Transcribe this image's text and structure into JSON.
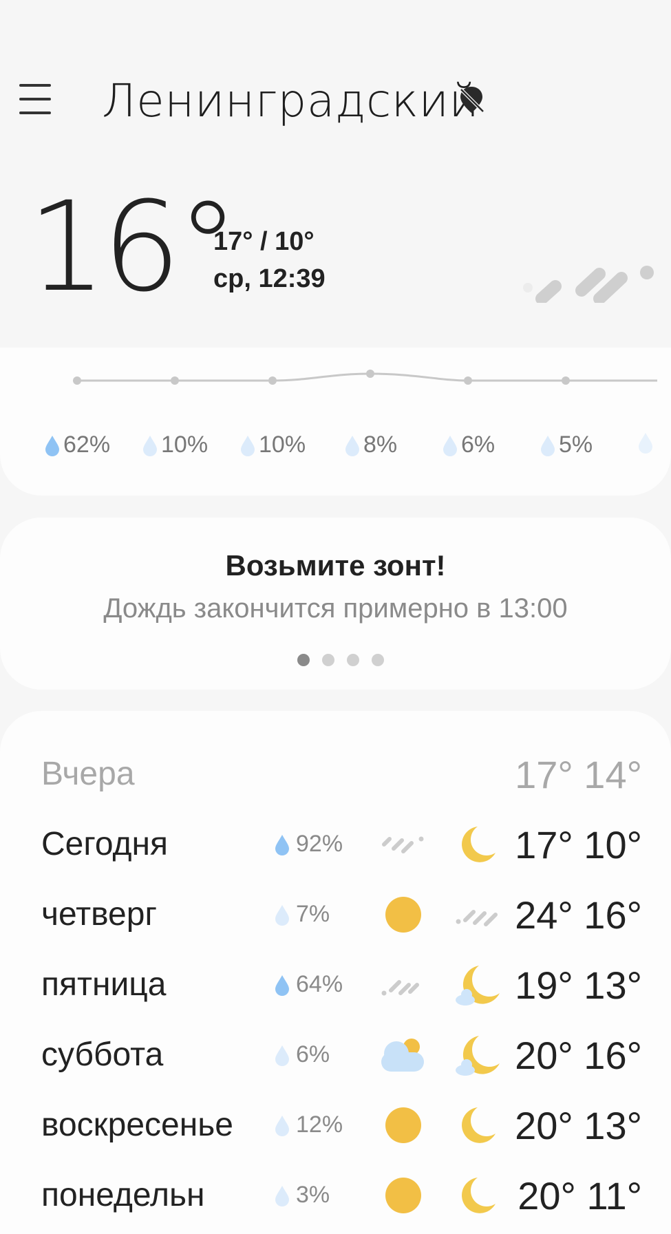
{
  "header": {
    "city": "Ленинградский"
  },
  "current": {
    "temp": "16°",
    "hi_lo": "17° / 10°",
    "datetime": "ср, 12:39"
  },
  "hourly": {
    "precip": [
      "62%",
      "10%",
      "10%",
      "8%",
      "6%",
      "5%"
    ]
  },
  "tip": {
    "title": "Возьмите зонт!",
    "subtitle": "Дождь закончится примерно в 13:00"
  },
  "daily": [
    {
      "name": "Вчера",
      "precip": "",
      "day_icon": "",
      "night_icon": "",
      "temps": "17° 14°"
    },
    {
      "name": "Сегодня",
      "precip": "92%",
      "day_icon": "rain-icon",
      "night_icon": "moon-icon",
      "temps": "17° 10°"
    },
    {
      "name": "четверг",
      "precip": "7%",
      "day_icon": "sun-icon",
      "night_icon": "rain-icon",
      "temps": "24° 16°"
    },
    {
      "name": "пятница",
      "precip": "64%",
      "day_icon": "rain-icon",
      "night_icon": "moon-cloud-icon",
      "temps": "19° 13°"
    },
    {
      "name": "суббота",
      "precip": "6%",
      "day_icon": "cloud-sun-icon",
      "night_icon": "moon-cloud-icon",
      "temps": "20° 16°"
    },
    {
      "name": "воскресенье",
      "precip": "12%",
      "day_icon": "sun-icon",
      "night_icon": "moon-icon",
      "temps": "20° 13°"
    },
    {
      "name": "понедельн",
      "precip": "3%",
      "day_icon": "sun-icon",
      "night_icon": "moon-icon",
      "temps": "20° 11°"
    }
  ],
  "colors": {
    "sun": "#f2bf45",
    "drop_strong": "#8fc3f4",
    "drop_light": "#dcebfb",
    "rain_dash": "#cccccc"
  }
}
